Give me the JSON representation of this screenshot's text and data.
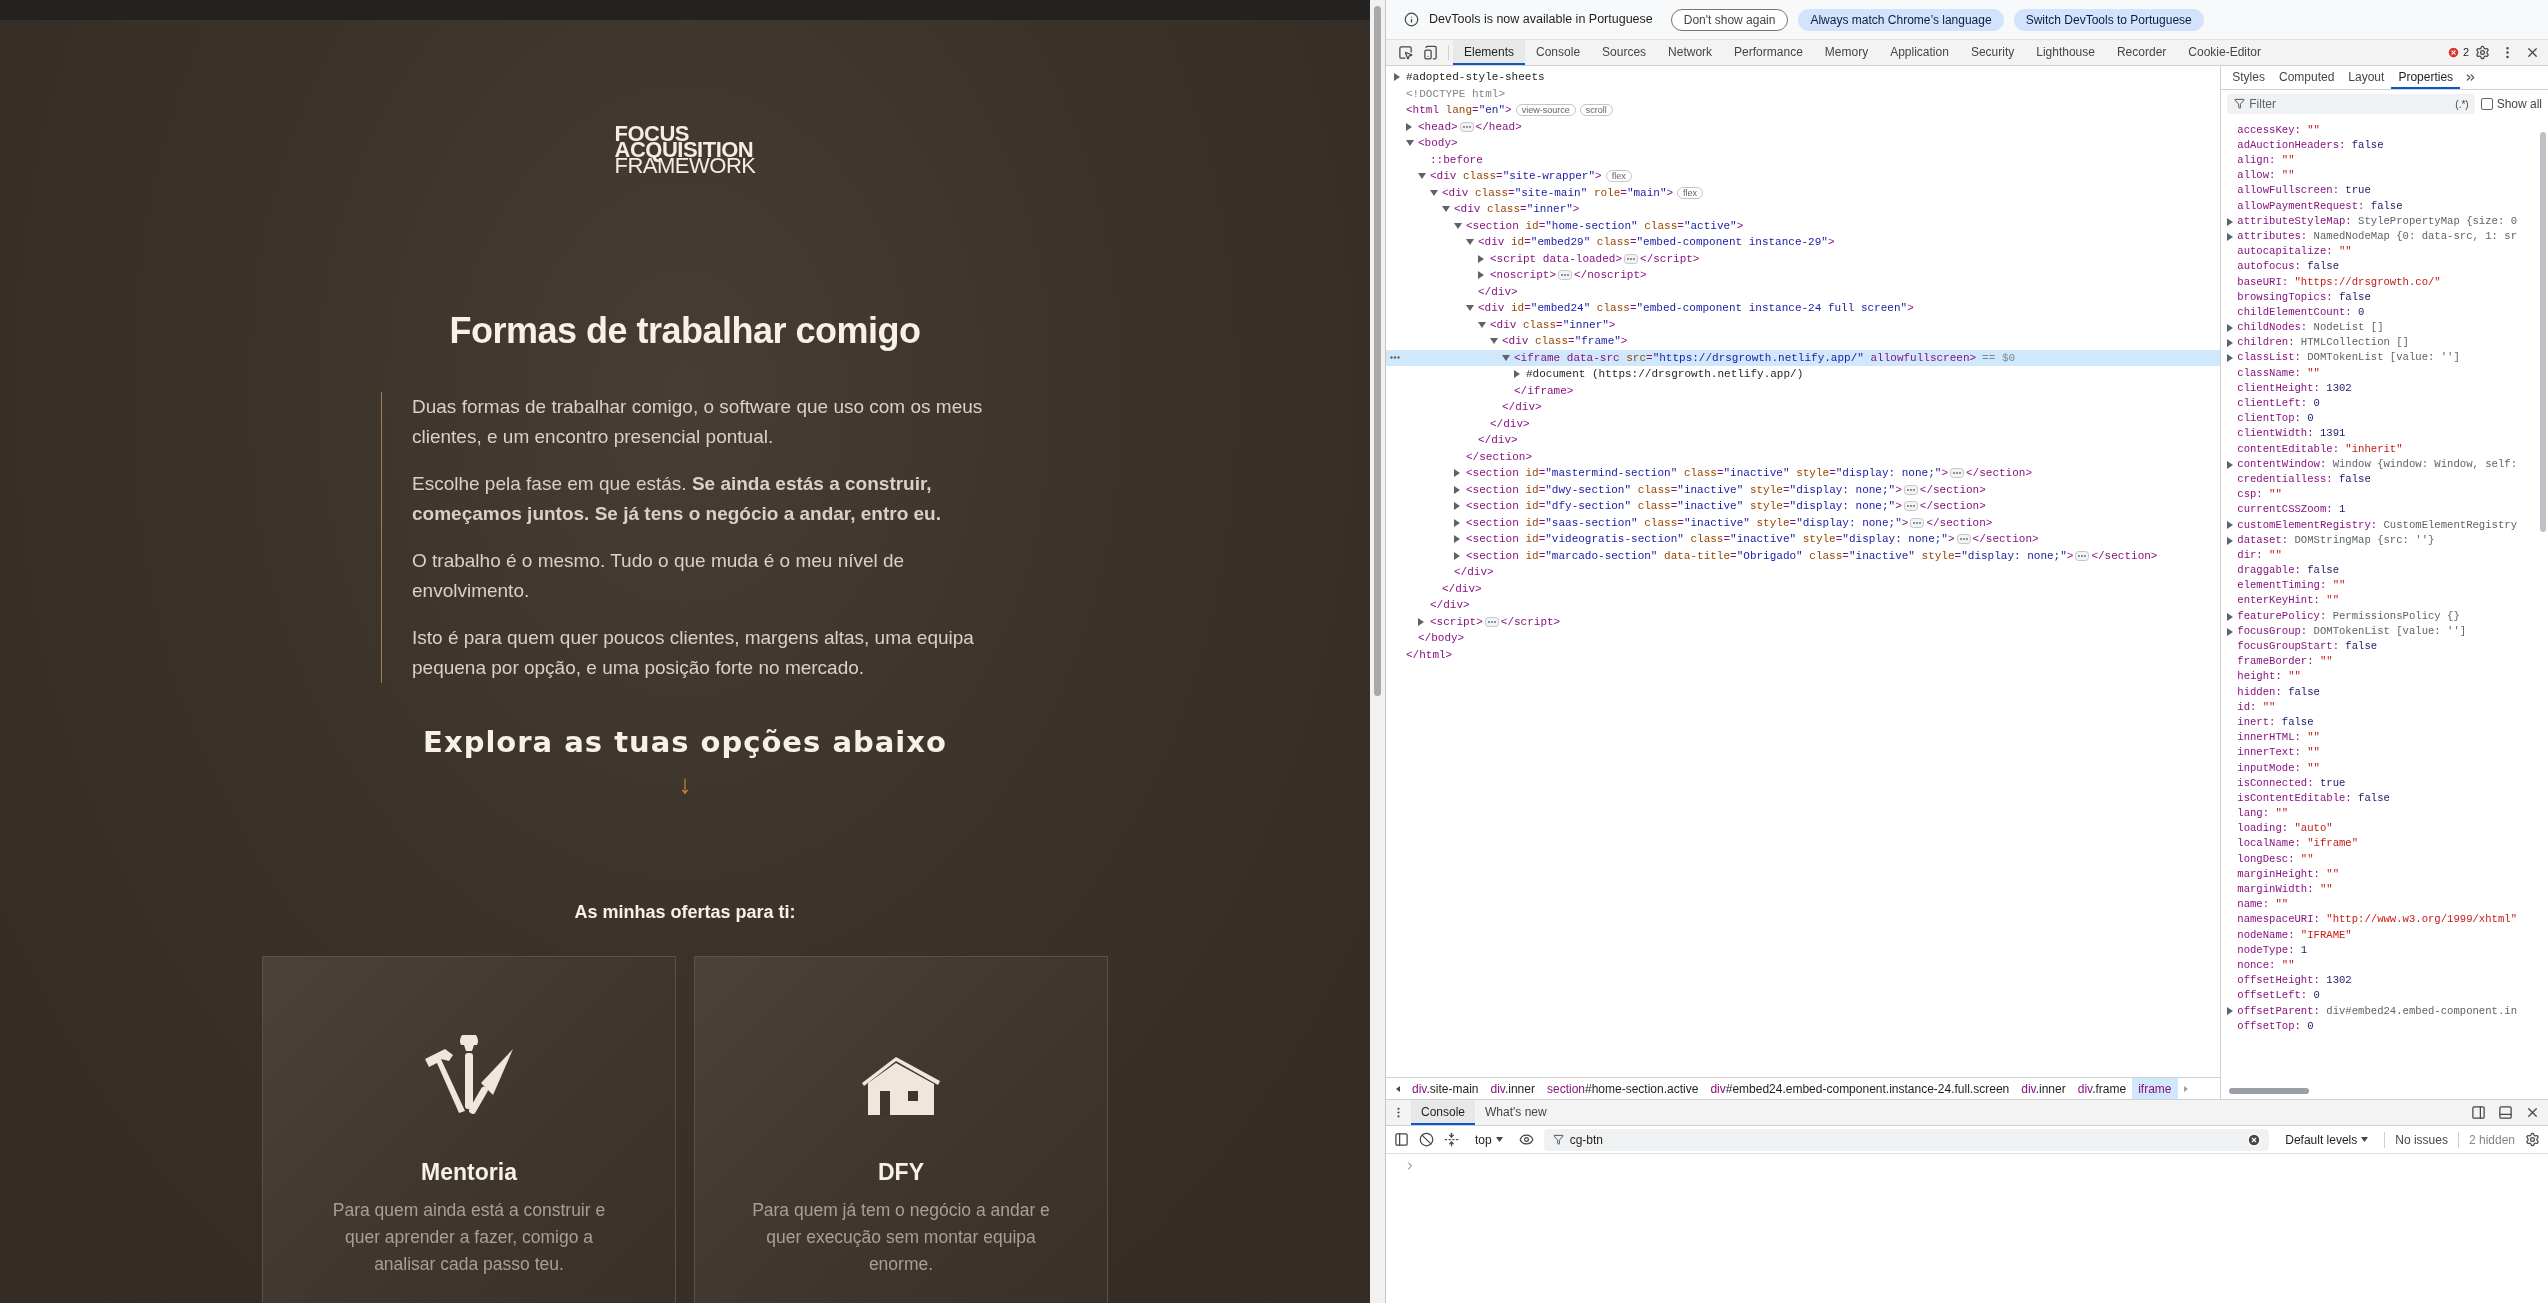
{
  "page": {
    "logo": [
      "FOCUS",
      "ACQUISITION",
      "FRAMEWORK"
    ],
    "heading": "Formas de trabalhar comigo",
    "paragraphs": [
      "Duas formas de trabalhar comigo, o software que uso com os meus clientes, e um encontro presencial pontual.",
      "Escolhe pela fase em que estás. **Se ainda estás a construir, começamos juntos. Se já tens o negócio a andar, entro eu.**",
      "O trabalho é o mesmo. Tudo o que muda é o meu nível de envolvimento.",
      "Isto é para quem quer poucos clientes, margens altas, uma equipa pequena por opção, e uma posição forte no mercado."
    ],
    "explore": "Explora as tuas opções abaixo",
    "arrow": "↓",
    "offers_title": "As minhas ofertas para ti:",
    "cards": [
      {
        "kind": "tools",
        "title": "Mentoria",
        "description": "Para quem ainda está a construir e quer aprender a fazer, comigo a analisar cada passo teu."
      },
      {
        "kind": "house",
        "title": "DFY",
        "description": "Para quem já tem o negócio a andar e quer execução sem montar equipa enorme."
      }
    ]
  },
  "devtools": {
    "infobar": {
      "message": "DevTools is now available in Portuguese",
      "buttons": [
        {
          "label": "Don't show again",
          "kind": "outline"
        },
        {
          "label": "Always match Chrome’s language",
          "kind": "filled"
        },
        {
          "label": "Switch DevTools to Portuguese",
          "kind": "filled"
        }
      ]
    },
    "tabs": [
      {
        "label": "Elements",
        "selected": true
      },
      {
        "label": "Console",
        "selected": false
      },
      {
        "label": "Sources",
        "selected": false
      },
      {
        "label": "Network",
        "selected": false
      },
      {
        "label": "Performance",
        "selected": false
      },
      {
        "label": "Memory",
        "selected": false
      },
      {
        "label": "Application",
        "selected": false
      },
      {
        "label": "Security",
        "selected": false
      },
      {
        "label": "Lighthouse",
        "selected": false
      },
      {
        "label": "Recorder",
        "selected": false
      },
      {
        "label": "Cookie-Editor",
        "selected": false
      }
    ],
    "error_count": "2",
    "dom_tree": [
      {
        "kind": "node",
        "open": "#adopted-style-sheets",
        "expanded": false,
        "selected": false
      },
      {
        "kind": "doctype",
        "open": "<!DOCTYPE html>"
      },
      {
        "kind": "root",
        "open": "<html lang=\"en\">",
        "badges": [
          "view-source",
          "scroll"
        ],
        "close": "</html>",
        "children": [
          {
            "kind": "element",
            "open": "<head>",
            "close": "</head>",
            "expanded": false,
            "selected": false
          },
          {
            "kind": "element",
            "open": "<body>",
            "close": "</body>",
            "expanded": true,
            "selected": false,
            "children": [
              {
                "kind": "pseudo",
                "open": "::before"
              },
              {
                "kind": "element",
                "open": "<div class=\"site-wrapper\">",
                "badges": [
                  "flex"
                ],
                "close": "</div>",
                "expanded": true,
                "selected": false,
                "children": [
                  {
                    "kind": "element",
                    "open": "<div class=\"site-main\" role=\"main\">",
                    "badges": [
                      "flex"
                    ],
                    "close": "</div>",
                    "expanded": true,
                    "selected": false,
                    "children": [
                      {
                        "kind": "element",
                        "open": "<div class=\"inner\">",
                        "close": "</div>",
                        "expanded": true,
                        "selected": false,
                        "children": [
                          {
                            "kind": "element",
                            "open": "<section id=\"home-section\" class=\"active\">",
                            "close": "</section>",
                            "expanded": true,
                            "selected": false,
                            "children": [
                              {
                                "kind": "element",
                                "open": "<div id=\"embed29\" class=\"embed-component instance-29\">",
                                "close": "</div>",
                                "expanded": true,
                                "selected": false,
                                "children": [
                                  {
                                    "kind": "element",
                                    "open": "<script data-loaded>",
                                    "close": "</script>",
                                    "expanded": false,
                                    "selected": false
                                  },
                                  {
                                    "kind": "element",
                                    "open": "<noscript>",
                                    "close": "</noscript>",
                                    "expanded": false,
                                    "selected": false
                                  }
                                ]
                              },
                              {
                                "kind": "element",
                                "open": "<div id=\"embed24\" class=\"embed-component instance-24 full screen\">",
                                "close": "</div>",
                                "expanded": true,
                                "selected": false,
                                "children": [
                                  {
                                    "kind": "element",
                                    "open": "<div class=\"inner\">",
                                    "close": "</div>",
                                    "expanded": true,
                                    "selected": false,
                                    "children": [
                                      {
                                        "kind": "element",
                                        "open": "<div class=\"frame\">",
                                        "close": "</div>",
                                        "expanded": true,
                                        "selected": false,
                                        "children": [
                                          {
                                            "kind": "element",
                                            "open": "<iframe data-src src=\"https://drsgrowth.netlify.app/\" allowfullscreen>",
                                            "suffix": "== $0",
                                            "close": "</iframe>",
                                            "expanded": true,
                                            "selected": true,
                                            "children": [
                                              {
                                                "kind": "node",
                                                "open": "#document (https://drsgrowth.netlify.app/)",
                                                "expanded": false,
                                                "selected": false
                                              }
                                            ]
                                          }
                                        ]
                                      }
                                    ]
                                  }
                                ]
                              }
                            ]
                          },
                          {
                            "kind": "element",
                            "open": "<section id=\"mastermind-section\" class=\"inactive\" style=\"display: none;\">",
                            "close": "</section>",
                            "expanded": false,
                            "selected": false
                          },
                          {
                            "kind": "element",
                            "open": "<section id=\"dwy-section\" class=\"inactive\" style=\"display: none;\">",
                            "close": "</section>",
                            "expanded": false,
                            "selected": false
                          },
                          {
                            "kind": "element",
                            "open": "<section id=\"dfy-section\" class=\"inactive\" style=\"display: none;\">",
                            "close": "</section>",
                            "expanded": false,
                            "selected": false
                          },
                          {
                            "kind": "element",
                            "open": "<section id=\"saas-section\" class=\"inactive\" style=\"display: none;\">",
                            "close": "</section>",
                            "expanded": false,
                            "selected": false
                          },
                          {
                            "kind": "element",
                            "open": "<section id=\"videogratis-section\" class=\"inactive\" style=\"display: none;\">",
                            "close": "</section>",
                            "expanded": false,
                            "selected": false
                          },
                          {
                            "kind": "element",
                            "open": "<section id=\"marcado-section\" data-title=\"Obrigado\" class=\"inactive\" style=\"display: none;\">",
                            "close": "</section>",
                            "expanded": false,
                            "selected": false
                          }
                        ]
                      }
                    ]
                  }
                ]
              },
              {
                "kind": "element",
                "open": "<script>",
                "close": "</script>",
                "expanded": false,
                "selected": false
              }
            ]
          }
        ]
      }
    ],
    "breadcrumbs": [
      {
        "label": "div.site-main",
        "selected": false
      },
      {
        "label": "div.inner",
        "selected": false
      },
      {
        "label": "section#home-section.active",
        "selected": false
      },
      {
        "label": "div#embed24.embed-component.instance-24.full.screen",
        "selected": false
      },
      {
        "label": "div.inner",
        "selected": false
      },
      {
        "label": "div.frame",
        "selected": false
      },
      {
        "label": "iframe",
        "selected": true
      }
    ],
    "side_tabs": [
      {
        "label": "Styles",
        "selected": false
      },
      {
        "label": "Computed",
        "selected": false
      },
      {
        "label": "Layout",
        "selected": false
      },
      {
        "label": "Properties",
        "selected": true
      }
    ],
    "filter": {
      "placeholder": "Filter",
      "regex_label": "(.*)",
      "show_all": {
        "label": "Show all",
        "checked": false
      }
    },
    "properties": [
      {
        "name": "accessKey:",
        "value": "\"\"",
        "kind": "string",
        "expandable": false
      },
      {
        "name": "adAuctionHeaders:",
        "value": "false",
        "kind": "literal",
        "expandable": false
      },
      {
        "name": "align:",
        "value": "\"\"",
        "kind": "string",
        "expandable": false
      },
      {
        "name": "allow:",
        "value": "\"\"",
        "kind": "string",
        "expandable": false
      },
      {
        "name": "allowFullscreen:",
        "value": "true",
        "kind": "literal",
        "expandable": false
      },
      {
        "name": "allowPaymentRequest:",
        "value": "false",
        "kind": "literal",
        "expandable": false
      },
      {
        "name": "attributeStyleMap:",
        "value": "StylePropertyMap {size: 0",
        "kind": "object",
        "expandable": true
      },
      {
        "name": "attributes:",
        "value": "NamedNodeMap {0: data-src, 1: sr",
        "kind": "object",
        "expandable": true
      },
      {
        "name": "autocapitalize:",
        "value": "\"\"",
        "kind": "string",
        "expandable": false
      },
      {
        "name": "autofocus:",
        "value": "false",
        "kind": "literal",
        "expandable": false
      },
      {
        "name": "baseURI:",
        "value": "\"https://drsgrowth.co/\"",
        "kind": "string",
        "expandable": false
      },
      {
        "name": "browsingTopics:",
        "value": "false",
        "kind": "literal",
        "expandable": false
      },
      {
        "name": "childElementCount:",
        "value": "0",
        "kind": "literal",
        "expandable": false
      },
      {
        "name": "childNodes:",
        "value": "NodeList []",
        "kind": "object",
        "expandable": true
      },
      {
        "name": "children:",
        "value": "HTMLCollection []",
        "kind": "object",
        "expandable": true
      },
      {
        "name": "classList:",
        "value": "DOMTokenList [value: '']",
        "kind": "object",
        "expandable": true
      },
      {
        "name": "className:",
        "value": "\"\"",
        "kind": "string",
        "expandable": false
      },
      {
        "name": "clientHeight:",
        "value": "1302",
        "kind": "literal",
        "expandable": false
      },
      {
        "name": "clientLeft:",
        "value": "0",
        "kind": "literal",
        "expandable": false
      },
      {
        "name": "clientTop:",
        "value": "0",
        "kind": "literal",
        "expandable": false
      },
      {
        "name": "clientWidth:",
        "value": "1391",
        "kind": "literal",
        "expandable": false
      },
      {
        "name": "contentEditable:",
        "value": "\"inherit\"",
        "kind": "string",
        "expandable": false
      },
      {
        "name": "contentWindow:",
        "value": "Window {window: Window, self:",
        "kind": "object",
        "expandable": true
      },
      {
        "name": "credentialless:",
        "value": "false",
        "kind": "literal",
        "expandable": false
      },
      {
        "name": "csp:",
        "value": "\"\"",
        "kind": "string",
        "expandable": false
      },
      {
        "name": "currentCSSZoom:",
        "value": "1",
        "kind": "literal",
        "expandable": false
      },
      {
        "name": "customElementRegistry:",
        "value": "CustomElementRegistry",
        "kind": "object",
        "expandable": true
      },
      {
        "name": "dataset:",
        "value": "DOMStringMap {src: ''}",
        "kind": "object",
        "expandable": true
      },
      {
        "name": "dir:",
        "value": "\"\"",
        "kind": "string",
        "expandable": false
      },
      {
        "name": "draggable:",
        "value": "false",
        "kind": "literal",
        "expandable": false
      },
      {
        "name": "elementTiming:",
        "value": "\"\"",
        "kind": "string",
        "expandable": false
      },
      {
        "name": "enterKeyHint:",
        "value": "\"\"",
        "kind": "string",
        "expandable": false
      },
      {
        "name": "featurePolicy:",
        "value": "PermissionsPolicy {}",
        "kind": "object",
        "expandable": true
      },
      {
        "name": "focusGroup:",
        "value": "DOMTokenList [value: '']",
        "kind": "object",
        "expandable": true
      },
      {
        "name": "focusGroupStart:",
        "value": "false",
        "kind": "literal",
        "expandable": false
      },
      {
        "name": "frameBorder:",
        "value": "\"\"",
        "kind": "string",
        "expandable": false
      },
      {
        "name": "height:",
        "value": "\"\"",
        "kind": "string",
        "expandable": false
      },
      {
        "name": "hidden:",
        "value": "false",
        "kind": "literal",
        "expandable": false
      },
      {
        "name": "id:",
        "value": "\"\"",
        "kind": "string",
        "expandable": false
      },
      {
        "name": "inert:",
        "value": "false",
        "kind": "literal",
        "expandable": false
      },
      {
        "name": "innerHTML:",
        "value": "\"\"",
        "kind": "string",
        "expandable": false
      },
      {
        "name": "innerText:",
        "value": "\"\"",
        "kind": "string",
        "expandable": false
      },
      {
        "name": "inputMode:",
        "value": "\"\"",
        "kind": "string",
        "expandable": false
      },
      {
        "name": "isConnected:",
        "value": "true",
        "kind": "literal",
        "expandable": false
      },
      {
        "name": "isContentEditable:",
        "value": "false",
        "kind": "literal",
        "expandable": false
      },
      {
        "name": "lang:",
        "value": "\"\"",
        "kind": "string",
        "expandable": false
      },
      {
        "name": "loading:",
        "value": "\"auto\"",
        "kind": "string",
        "expandable": false
      },
      {
        "name": "localName:",
        "value": "\"iframe\"",
        "kind": "string",
        "expandable": false
      },
      {
        "name": "longDesc:",
        "value": "\"\"",
        "kind": "string",
        "expandable": false
      },
      {
        "name": "marginHeight:",
        "value": "\"\"",
        "kind": "string",
        "expandable": false
      },
      {
        "name": "marginWidth:",
        "value": "\"\"",
        "kind": "string",
        "expandable": false
      },
      {
        "name": "name:",
        "value": "\"\"",
        "kind": "string",
        "expandable": false
      },
      {
        "name": "namespaceURI:",
        "value": "\"http://www.w3.org/1999/xhtml\"",
        "kind": "string",
        "expandable": false
      },
      {
        "name": "nodeName:",
        "value": "\"IFRAME\"",
        "kind": "string",
        "expandable": false
      },
      {
        "name": "nodeType:",
        "value": "1",
        "kind": "literal",
        "expandable": false
      },
      {
        "name": "nonce:",
        "value": "\"\"",
        "kind": "string",
        "expandable": false
      },
      {
        "name": "offsetHeight:",
        "value": "1302",
        "kind": "literal",
        "expandable": false
      },
      {
        "name": "offsetLeft:",
        "value": "0",
        "kind": "literal",
        "expandable": false
      },
      {
        "name": "offsetParent:",
        "value": "div#embed24.embed-component.in",
        "kind": "object",
        "expandable": true
      },
      {
        "name": "offsetTop:",
        "value": "0",
        "kind": "literal",
        "expandable": false
      }
    ],
    "drawer": {
      "tabs": [
        {
          "label": "Console",
          "selected": true
        },
        {
          "label": "What's new",
          "selected": false
        }
      ],
      "context": "top",
      "filter_value": "cg-btn",
      "levels": "Default levels",
      "issues": "No issues",
      "hidden": "2 hidden"
    }
  }
}
